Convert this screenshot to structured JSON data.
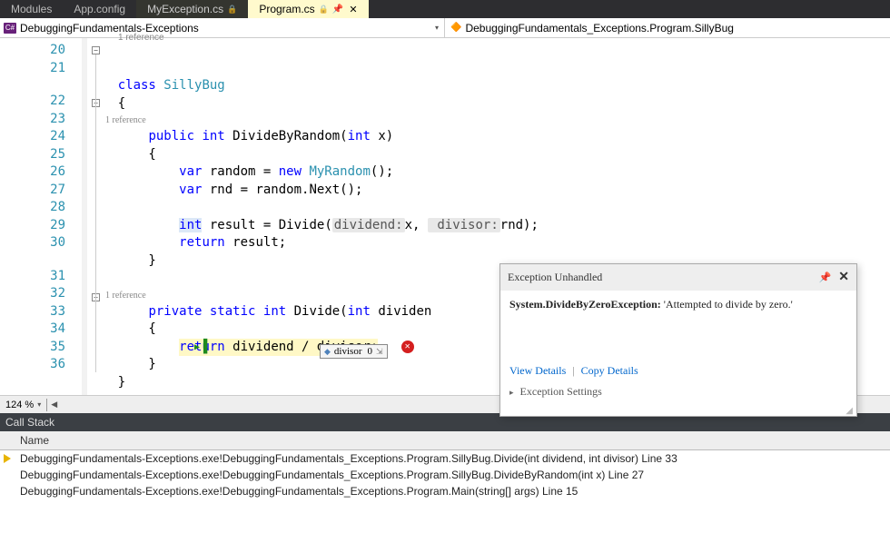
{
  "tabs": [
    {
      "label": "Modules"
    },
    {
      "label": "App.config"
    },
    {
      "label": "MyException.cs",
      "locked": true
    },
    {
      "label": "Program.cs",
      "locked": true,
      "pinned": true,
      "active": true
    }
  ],
  "breadcrumb": {
    "left": "DebuggingFundamentals-Exceptions",
    "right": "DebuggingFundamentals_Exceptions.Program.SillyBug"
  },
  "code": {
    "ref1": "1 reference",
    "lines": {
      "20": {
        "tokens": [
          {
            "t": "    ",
            "c": ""
          },
          {
            "t": "class ",
            "c": "kw"
          },
          {
            "t": "SillyBug",
            "c": "typ"
          }
        ]
      },
      "21": {
        "tokens": [
          {
            "t": "    {",
            "c": ""
          }
        ]
      },
      "ref_a": "1 reference",
      "22": {
        "tokens": [
          {
            "t": "        ",
            "c": ""
          },
          {
            "t": "public ",
            "c": "kw"
          },
          {
            "t": "int ",
            "c": "kw"
          },
          {
            "t": "DivideByRandom(",
            "c": ""
          },
          {
            "t": "int ",
            "c": "kw"
          },
          {
            "t": "x)",
            "c": ""
          }
        ]
      },
      "23": {
        "tokens": [
          {
            "t": "        {",
            "c": ""
          }
        ]
      },
      "24": {
        "tokens": [
          {
            "t": "            ",
            "c": ""
          },
          {
            "t": "var ",
            "c": "kw"
          },
          {
            "t": "random = ",
            "c": ""
          },
          {
            "t": "new ",
            "c": "kw"
          },
          {
            "t": "MyRandom",
            "c": "typ"
          },
          {
            "t": "();",
            "c": ""
          }
        ]
      },
      "25": {
        "tokens": [
          {
            "t": "            ",
            "c": ""
          },
          {
            "t": "var ",
            "c": "kw"
          },
          {
            "t": "rnd = random.Next();",
            "c": ""
          }
        ]
      },
      "26": {
        "tokens": [
          {
            "t": "",
            "c": ""
          }
        ]
      },
      "27": {
        "tokens": [
          {
            "t": "            ",
            "c": ""
          },
          {
            "t": "int",
            "c": "kw type-hl"
          },
          {
            "t": " result = Divide(",
            "c": ""
          },
          {
            "t": "dividend:",
            "c": "param-hint"
          },
          {
            "t": "x, ",
            "c": ""
          },
          {
            "t": " divisor:",
            "c": "param-hint"
          },
          {
            "t": "rnd);",
            "c": ""
          }
        ]
      },
      "28": {
        "tokens": [
          {
            "t": "            ",
            "c": ""
          },
          {
            "t": "return ",
            "c": "kw"
          },
          {
            "t": "result;",
            "c": ""
          }
        ]
      },
      "29": {
        "tokens": [
          {
            "t": "        }",
            "c": ""
          }
        ]
      },
      "30": {
        "tokens": [
          {
            "t": "",
            "c": ""
          }
        ]
      },
      "ref_b": "1 reference",
      "31": {
        "tokens": [
          {
            "t": "        ",
            "c": ""
          },
          {
            "t": "private ",
            "c": "kw"
          },
          {
            "t": "static ",
            "c": "kw"
          },
          {
            "t": "int ",
            "c": "kw"
          },
          {
            "t": "Divide(",
            "c": ""
          },
          {
            "t": "int ",
            "c": "kw"
          },
          {
            "t": "dividen",
            "c": ""
          }
        ]
      },
      "32": {
        "tokens": [
          {
            "t": "        {",
            "c": ""
          }
        ]
      },
      "33": {
        "pre": "            ",
        "hl": "return dividend / divisor;"
      },
      "34": {
        "tokens": [
          {
            "t": "        }",
            "c": ""
          }
        ]
      },
      "35": {
        "tokens": [
          {
            "t": "    }",
            "c": ""
          }
        ]
      },
      "36": {
        "tokens": [
          {
            "t": "",
            "c": ""
          }
        ]
      }
    },
    "line_start": 20,
    "line_end": 36
  },
  "datatip": {
    "name": "divisor",
    "value": "0"
  },
  "exception": {
    "title": "Exception Unhandled",
    "type": "System.DivideByZeroException:",
    "message": "'Attempted to divide by zero.'",
    "view_details": "View Details",
    "copy_details": "Copy Details",
    "settings": "Exception Settings"
  },
  "zoom": "124 %",
  "callstack": {
    "title": "Call Stack",
    "header": "Name",
    "frames": [
      {
        "current": true,
        "text": "DebuggingFundamentals-Exceptions.exe!DebuggingFundamentals_Exceptions.Program.SillyBug.Divide(int dividend, int divisor) Line 33"
      },
      {
        "current": false,
        "text": "DebuggingFundamentals-Exceptions.exe!DebuggingFundamentals_Exceptions.Program.SillyBug.DivideByRandom(int x) Line 27"
      },
      {
        "current": false,
        "text": "DebuggingFundamentals-Exceptions.exe!DebuggingFundamentals_Exceptions.Program.Main(string[] args) Line 15"
      }
    ]
  }
}
